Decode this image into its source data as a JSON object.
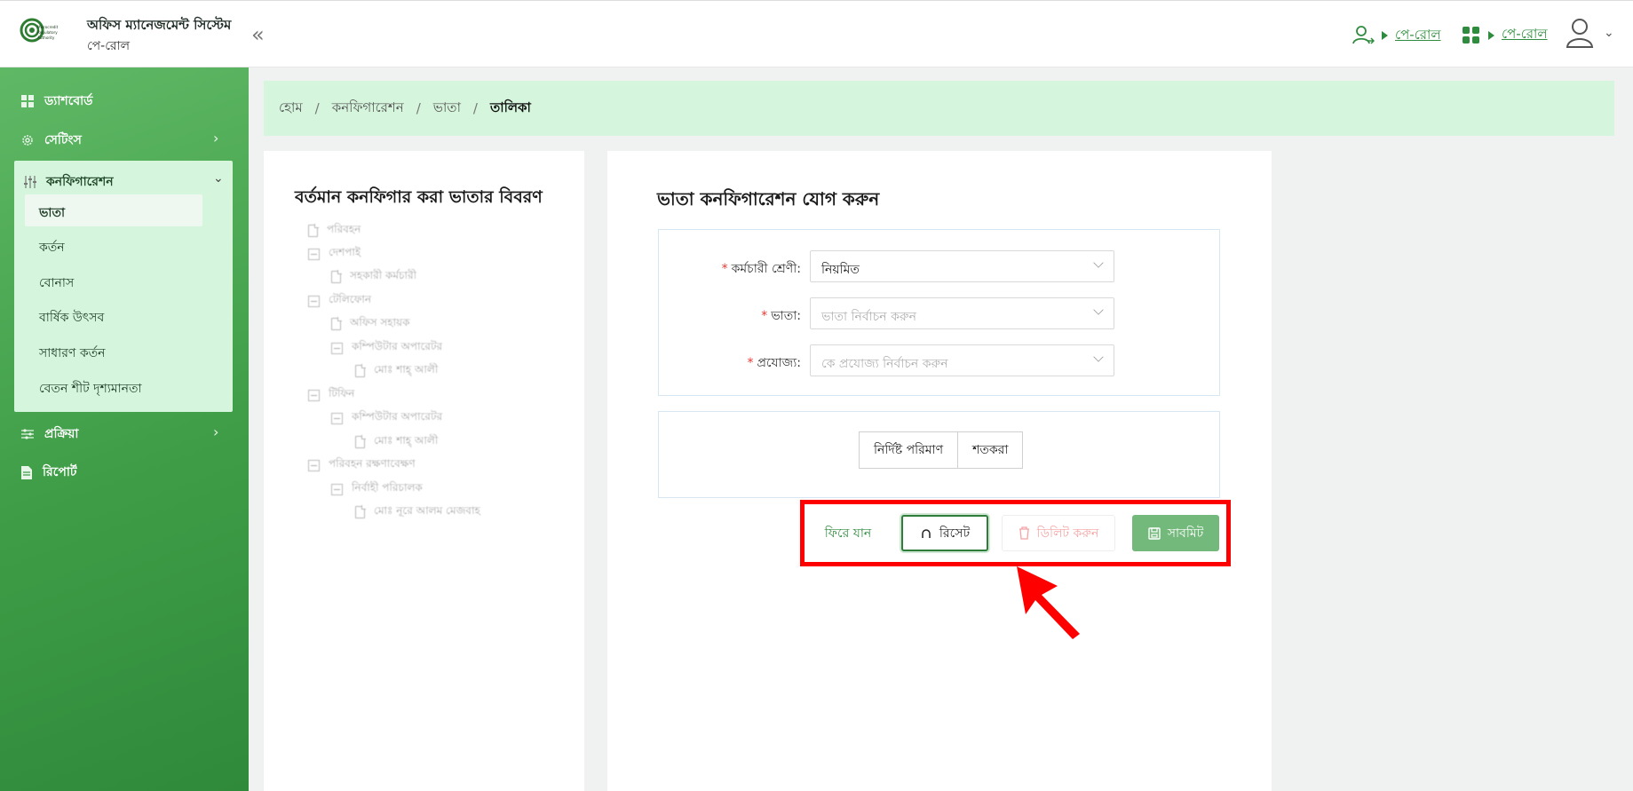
{
  "header": {
    "logo_text": "Microcredit Regulatory Authority",
    "app_title": "অফিস ম্যানেজমেন্ট সিস্টেম",
    "app_subtitle": "পে-রোল",
    "collapse_symbol": "«",
    "link1_label": "পে-রোল",
    "link2_label": "পে-রোল"
  },
  "sidebar": {
    "dashboard": "ড্যাশবোর্ড",
    "settings": "সেটিংস",
    "configuration": "কনফিগারেশন",
    "sub_items": [
      "ভাতা",
      "কর্তন",
      "বোনাস",
      "বার্ষিক উৎসব",
      "সাধারণ কর্তন",
      "বেতন শীট দৃশ্যমানতা"
    ],
    "process": "প্রক্রিয়া",
    "report": "রিপোর্ট"
  },
  "breadcrumb": {
    "home": "হোম",
    "config": "কনফিগারেশন",
    "allowance": "ভাতা",
    "current": "তালিকা",
    "sep": "/"
  },
  "left_card": {
    "title": "বর্তমান কনফিগার করা ভাতার বিবরণ",
    "tree": [
      "পরিবহন",
      "দেশপাই",
      "সহকারী কর্মচারী",
      "টেলিফোন",
      "অফিস সহায়ক",
      "কম্পিউটার অপারেটর",
      "মোঃ শাহ্‌ আলী",
      "টিফিন",
      "কম্পিউটার অপারেটর",
      "মোঃ শাহ্‌ আলী",
      "পরিবহন রক্ষণাবেক্ষণ",
      "নির্বাহী পরিচালক",
      "মোঃ নূরে আলম মেজবাহ"
    ]
  },
  "form": {
    "title": "ভাতা কনফিগারেশন যোগ করুন",
    "employee_class_label": "কর্মচারী শ্রেণী:",
    "employee_class_value": "নিয়মিত",
    "allowance_label": "ভাতা:",
    "allowance_placeholder": "ভাতা নির্বাচন করুন",
    "applicable_label": "প্রযোজ্য:",
    "applicable_placeholder": "কে প্রযোজ্য নির্বাচন করুন",
    "required_mark": "*",
    "seg_fixed": "নির্দিষ্ট পরিমাণ",
    "seg_percent": "শতকরা"
  },
  "actions": {
    "back": "ফিরে যান",
    "reset": "রিসেট",
    "delete": "ডিলিট করুন",
    "submit": "সাবমিট"
  },
  "colors": {
    "brand_green": "#2f8b3e",
    "highlight": "#ff0000"
  }
}
